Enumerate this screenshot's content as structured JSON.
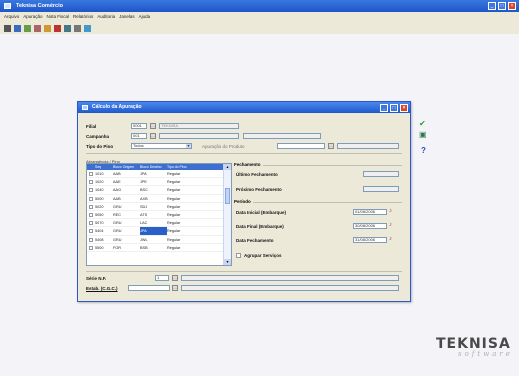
{
  "window": {
    "title": "Teknisa Comércio"
  },
  "menubar": {
    "items": [
      "Arquivo",
      "Apuração",
      "Nota Fiscal",
      "Relatórios",
      "Auditoria",
      "Janelas",
      "Ajuda"
    ]
  },
  "dialog": {
    "title": "Cálculo da Apuração",
    "filial": {
      "label": "Filial",
      "code": "0001",
      "name": "TEKNISA"
    },
    "campanha": {
      "label": "Campanha",
      "code": "001",
      "name": "",
      "extra": ""
    },
    "tipo_pino": {
      "label": "Tipo do Pino",
      "value": "Todos",
      "ref_label": "Apuração do Produto",
      "ref_value": ""
    },
    "grid": {
      "caption": "Abrangência / Pino",
      "columns": [
        "",
        "Seq",
        "Bloco Origem",
        "Bloco Destino",
        "Tipo do Pino"
      ],
      "rows": [
        [
          "",
          "1010",
          "AAB",
          "JPA",
          "Regular"
        ],
        [
          "",
          "1020",
          "AAE",
          "JPE",
          "Regular"
        ],
        [
          "",
          "1040",
          "AAG",
          "BSC",
          "Regular"
        ],
        [
          "",
          "5000",
          "AAB",
          "AXB",
          "Regular"
        ],
        [
          "",
          "5020",
          "GRU",
          "SDJ",
          "Regular"
        ],
        [
          "",
          "5050",
          "REC",
          "ATS",
          "Regular"
        ],
        [
          "",
          "5070",
          "GRU",
          "LAC",
          "Regular"
        ],
        [
          "",
          "5404",
          "GRU",
          "JPA",
          "Regular"
        ],
        [
          "",
          "5408",
          "GRU",
          "JWL",
          "Regular"
        ],
        [
          "",
          "5500",
          "FOR",
          "BSB",
          "Regular"
        ]
      ]
    },
    "fechamento": {
      "label": "Fechamento",
      "ultimo_label": "Último Fechamento",
      "ultimo_value": "",
      "proximo_label": "Próximo Fechamento",
      "proximo_value": ""
    },
    "periodo": {
      "label": "Período",
      "inicial_label": "Data Inicial (Embarque)",
      "inicial_value": "01/08/2006",
      "final_label": "Data Final (Embarque)",
      "final_value": "30/08/2006",
      "fechamento_label": "Data Fechamento",
      "fechamento_value": "31/08/2006",
      "agrupar_label": "Agrupar Serviços"
    },
    "bottom": {
      "serie_label": "Série N.F.",
      "serie_code": "1",
      "serie_desc": "",
      "estab_label": "Estab. (C.G.C.)",
      "estab_code": "",
      "estab_desc": ""
    }
  },
  "logo": {
    "name": "TEKNISA",
    "tag": "software"
  },
  "colors": {
    "titlebar": "#1d56c8",
    "accent_green": "#2c9a2c",
    "accent_red": "#b0302a",
    "selection": "#2a5ec9"
  }
}
